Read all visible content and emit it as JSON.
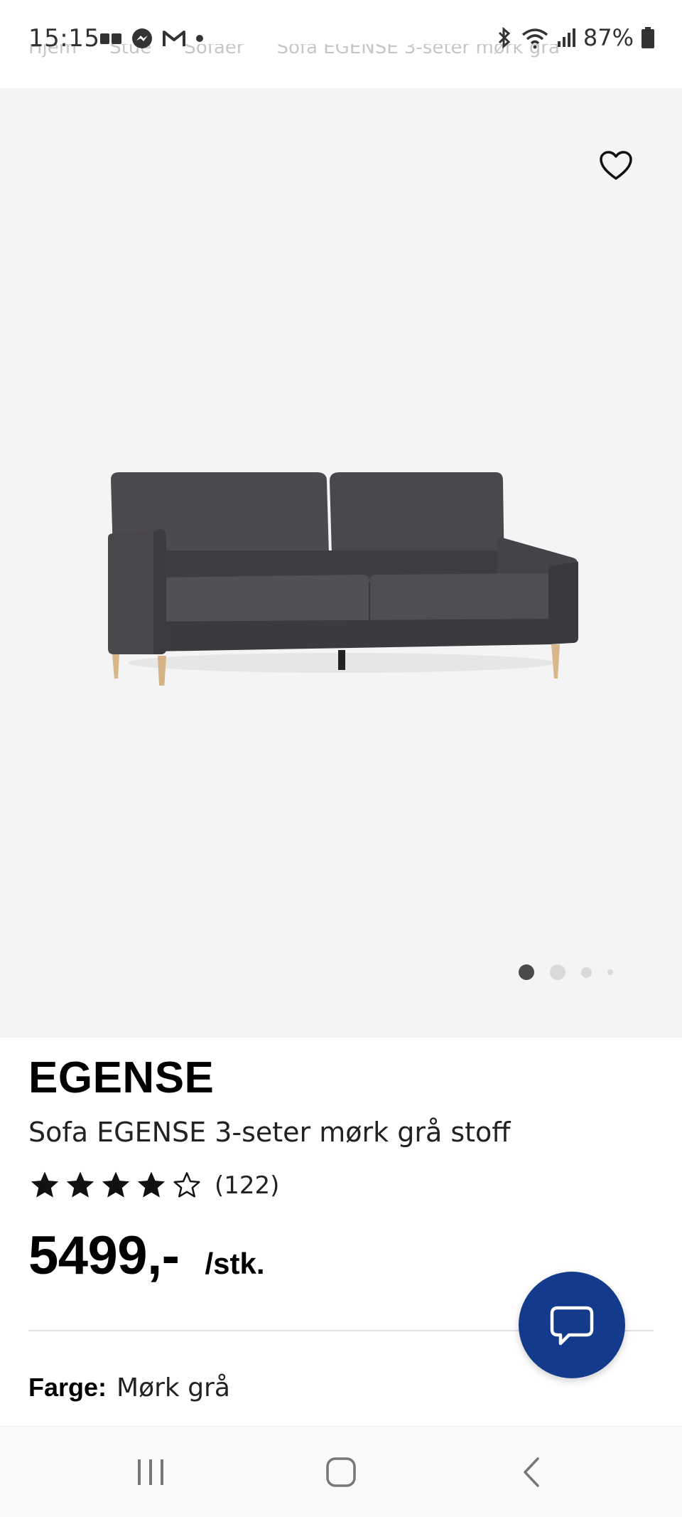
{
  "status_bar": {
    "time": "15:15",
    "battery": "87%"
  },
  "breadcrumb": [
    "Hjem",
    "Stue",
    "Sofaer",
    "Sofa EGENSE 3-seter mørk grå"
  ],
  "product": {
    "brand": "EGENSE",
    "name": "Sofa EGENSE 3-seter mørk grå stoff",
    "rating": 4,
    "rating_max": 5,
    "review_count": "(122)",
    "price": "5499,-",
    "unit": "/stk.",
    "color_label": "Farge:",
    "color_value": "Mørk grå"
  },
  "gallery": {
    "image_count": 4,
    "active_index": 0
  },
  "colors": {
    "chat_button": "#143a8c",
    "gallery_bg": "#f4f4f4",
    "sofa_fabric": "#4a474c"
  },
  "icons": {
    "favorite": "heart-outline-icon",
    "chat": "chat-bubble-icon",
    "recent_apps": "recent-apps-icon",
    "home": "home-icon",
    "back": "back-icon"
  }
}
